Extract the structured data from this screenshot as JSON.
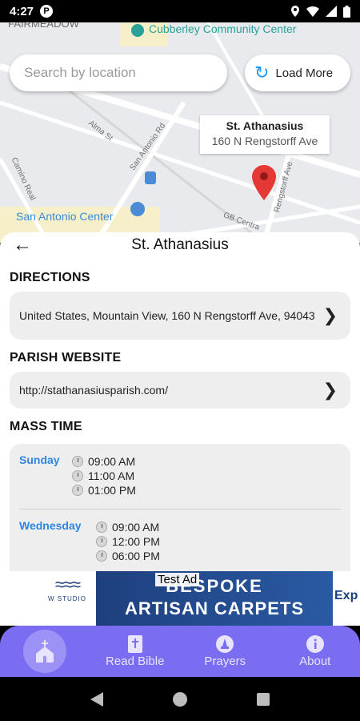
{
  "status_bar": {
    "time": "4:27",
    "app_icon": "P"
  },
  "map": {
    "labels": {
      "fairmeadow": "FAIRMEADOW",
      "community_center": "Cubberley Community Center",
      "san_antonio_center": "San Antonio Center",
      "alma_st": "Alma St",
      "san_antonio_rd": "San Antonio Rd",
      "rengstorff_ave": "Rengstorff Ave",
      "gb_central": "GB Centra",
      "camino_real": "Camino Real"
    },
    "search": {
      "placeholder": "Search by location",
      "value": ""
    },
    "load_more_label": "Load More",
    "marker": {
      "name": "St. Athanasius",
      "address": "160 N Rengstorff Ave"
    }
  },
  "sheet": {
    "title": "St. Athanasius",
    "directions": {
      "label": "DIRECTIONS",
      "address": "United States, Mountain View, 160 N Rengstorff Ave, 94043"
    },
    "website": {
      "label": "PARISH WEBSITE",
      "url": "http://stathanasiusparish.com/"
    },
    "mass": {
      "label": "MASS TIME",
      "days": [
        {
          "day": "Sunday",
          "times": [
            "09:00 AM",
            "11:00 AM",
            "01:00 PM"
          ]
        },
        {
          "day": "Wednesday",
          "times": [
            "09:00 AM",
            "12:00 PM",
            "06:00 PM"
          ]
        }
      ]
    }
  },
  "ad": {
    "tag": "Test Ad",
    "brand": "W STUDIO",
    "line1": "BESPOKE",
    "line2": "ARTISAN CARPETS",
    "right_text": "Exp"
  },
  "bottom_nav": {
    "items": [
      {
        "label": "",
        "icon": "church-icon"
      },
      {
        "label": "Read Bible",
        "icon": "bible-icon"
      },
      {
        "label": "Prayers",
        "icon": "prayer-icon"
      },
      {
        "label": "About",
        "icon": "info-icon"
      }
    ]
  },
  "colors": {
    "accent": "#7b6df2",
    "day_blue": "#2e86de",
    "pin_red": "#e53935"
  }
}
